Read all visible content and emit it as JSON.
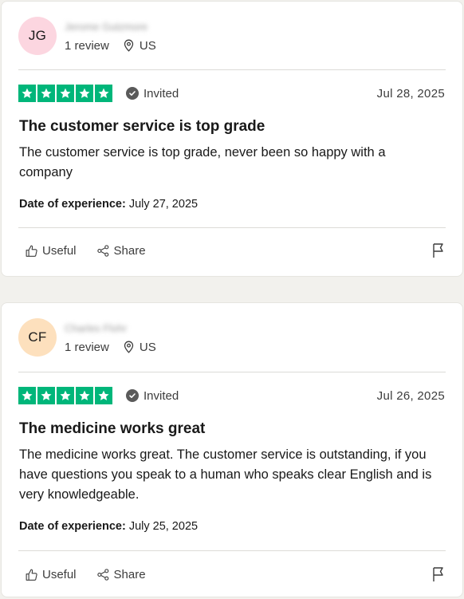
{
  "reviews": [
    {
      "initials": "JG",
      "avatar_color": "#fcd6e0",
      "name": "Jerome Gutzmore",
      "review_count": "1 review",
      "country": "US",
      "rating": 5,
      "invited_label": "Invited",
      "date": "Jul 28, 2025",
      "title": "The customer service is top grade",
      "body": "The customer service is top grade, never been so happy with a company",
      "experience_label": "Date of experience:",
      "experience_date": "July 27, 2025",
      "useful_label": "Useful",
      "share_label": "Share"
    },
    {
      "initials": "CF",
      "avatar_color": "#fde0bd",
      "name": "Charles Flohr",
      "review_count": "1 review",
      "country": "US",
      "rating": 5,
      "invited_label": "Invited",
      "date": "Jul 26, 2025",
      "title": "The medicine works great",
      "body": "The medicine works great. The customer service is outstanding, if you have questions you speak to a human who speaks clear English and is very knowledgeable.",
      "experience_label": "Date of experience:",
      "experience_date": "July 25, 2025",
      "useful_label": "Useful",
      "share_label": "Share"
    }
  ],
  "colors": {
    "star_green": "#00b67a",
    "card_bg": "#ffffff",
    "page_bg": "#f2f1ed"
  },
  "icons": [
    "location-pin-icon",
    "verified-check-icon",
    "star-icon",
    "thumbs-up-icon",
    "share-icon",
    "flag-icon"
  ]
}
